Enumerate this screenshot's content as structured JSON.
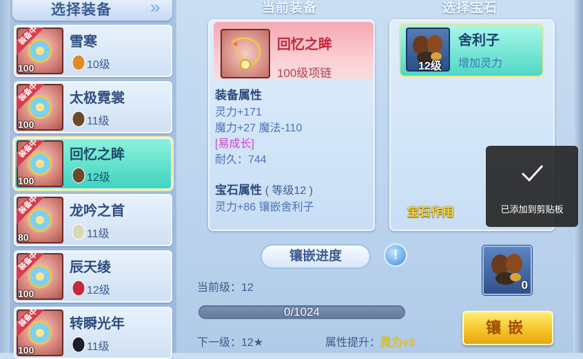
{
  "list": {
    "title": "选择装备",
    "items": [
      {
        "name": "雪寒",
        "level": "100",
        "badge": "装备中",
        "gem_level": "10级",
        "gem_color": "#e08a2c",
        "selected": false
      },
      {
        "name": "太极霓裳",
        "level": "100",
        "badge": "装备中",
        "gem_level": "11级",
        "gem_color": "#6b4a2b",
        "selected": false
      },
      {
        "name": "回忆之眸",
        "level": "100",
        "badge": "装备中",
        "gem_level": "12级",
        "gem_color": "#6b4a2b",
        "selected": true
      },
      {
        "name": "龙吟之首",
        "level": "80",
        "badge": "装备中",
        "gem_level": "11级",
        "gem_color": "#d9d8b8",
        "selected": false
      },
      {
        "name": "辰天绫",
        "level": "100",
        "badge": "装备中",
        "gem_level": "12级",
        "gem_color": "#c3293f",
        "selected": false
      },
      {
        "name": "转瞬光年",
        "level": "100",
        "badge": "装备中",
        "gem_level": "11级",
        "gem_color": "#1d1d2b",
        "selected": false
      }
    ]
  },
  "current": {
    "title": "当前装备",
    "name": "回忆之眸",
    "type": "100级项链",
    "equip_attr_title": "装备属性",
    "attrs": [
      "灵力+171",
      "魔力+27 魔法-110",
      "[易成长]",
      "耐久：744"
    ],
    "gem_attr_title": "宝石属性",
    "gem_attr_level": "( 等级12 )",
    "gem_attr": "灵力+86 镶嵌舍利子"
  },
  "gems": {
    "title": "选择宝石",
    "selected_name": "舍利子",
    "selected_effect": "增加灵力",
    "selected_level": "12级",
    "effect_label": "宝石作用"
  },
  "progress": {
    "title": "镶嵌进度",
    "current_level": "当前级：12",
    "value": 0,
    "max": 1024,
    "bar_text": "0/1024",
    "next_level": "下一级：12★",
    "attr_up_label": "属性提升：",
    "attr_up_value": "灵力+2",
    "info_icon": "!"
  },
  "slot": {
    "count": "0"
  },
  "inlay_button": "镶嵌",
  "toast": {
    "message": "已添加到剪贴板"
  },
  "colors": {
    "accent": "#3ed3c0",
    "gold": "#f4c52a",
    "badge": "#d83c4a"
  }
}
